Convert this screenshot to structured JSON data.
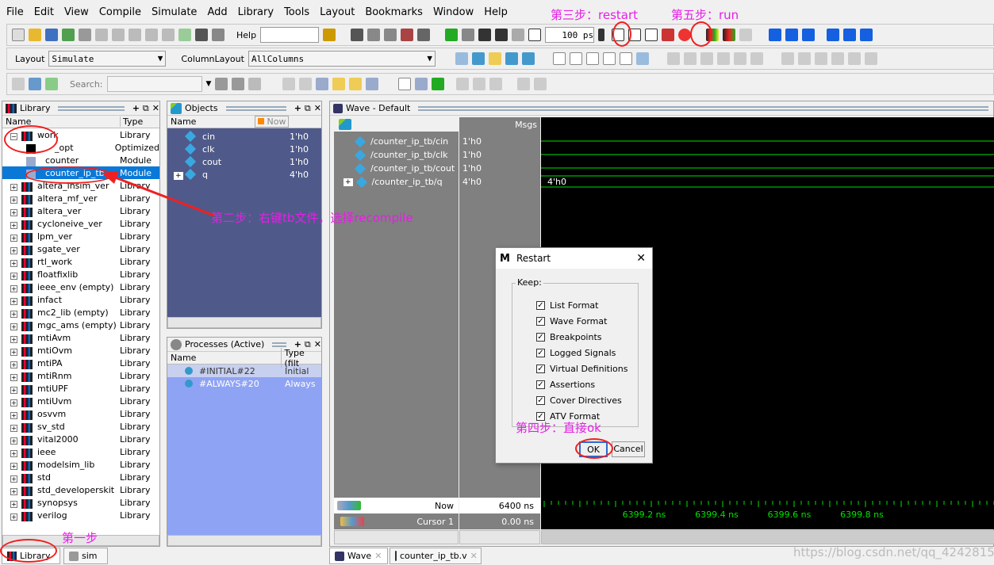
{
  "menu": [
    "File",
    "Edit",
    "View",
    "Compile",
    "Simulate",
    "Add",
    "Library",
    "Tools",
    "Layout",
    "Bookmarks",
    "Window",
    "Help"
  ],
  "toolbar": {
    "help_label": "Help",
    "help_value": "",
    "run_length": "100 ps",
    "layout_label": "Layout",
    "layout_value": "Simulate",
    "column_layout_label": "ColumnLayout",
    "column_layout_value": "AllColumns",
    "search_label": "Search:",
    "search_value": ""
  },
  "library": {
    "title": "Library",
    "col_name": "Name",
    "col_type": "Type",
    "items": [
      {
        "name": "work",
        "type": "Library",
        "level": 0,
        "expanded": true
      },
      {
        "name": "_opt",
        "type": "Optimized",
        "level": 1
      },
      {
        "name": "counter",
        "type": "Module",
        "level": 1
      },
      {
        "name": "counter_ip_tb",
        "type": "Module",
        "level": 1,
        "selected": true
      },
      {
        "name": "altera_lnsim_ver",
        "type": "Library"
      },
      {
        "name": "altera_mf_ver",
        "type": "Library"
      },
      {
        "name": "altera_ver",
        "type": "Library"
      },
      {
        "name": "cycloneive_ver",
        "type": "Library"
      },
      {
        "name": "lpm_ver",
        "type": "Library"
      },
      {
        "name": "sgate_ver",
        "type": "Library"
      },
      {
        "name": "rtl_work",
        "type": "Library"
      },
      {
        "name": "floatfixlib",
        "type": "Library"
      },
      {
        "name": "ieee_env  (empty)",
        "type": "Library"
      },
      {
        "name": "infact",
        "type": "Library"
      },
      {
        "name": "mc2_lib  (empty)",
        "type": "Library"
      },
      {
        "name": "mgc_ams  (empty)",
        "type": "Library"
      },
      {
        "name": "mtiAvm",
        "type": "Library"
      },
      {
        "name": "mtiOvm",
        "type": "Library"
      },
      {
        "name": "mtiPA",
        "type": "Library"
      },
      {
        "name": "mtiRnm",
        "type": "Library"
      },
      {
        "name": "mtiUPF",
        "type": "Library"
      },
      {
        "name": "mtiUvm",
        "type": "Library"
      },
      {
        "name": "osvvm",
        "type": "Library"
      },
      {
        "name": "sv_std",
        "type": "Library"
      },
      {
        "name": "vital2000",
        "type": "Library"
      },
      {
        "name": "ieee",
        "type": "Library"
      },
      {
        "name": "modelsim_lib",
        "type": "Library"
      },
      {
        "name": "std",
        "type": "Library"
      },
      {
        "name": "std_developerskit",
        "type": "Library"
      },
      {
        "name": "synopsys",
        "type": "Library"
      },
      {
        "name": "verilog",
        "type": "Library"
      }
    ],
    "tabs": [
      "Library",
      "sim"
    ]
  },
  "objects": {
    "title": "Objects",
    "col_name": "Name",
    "now_label": "Now",
    "items": [
      {
        "name": "cin",
        "value": "1'h0"
      },
      {
        "name": "clk",
        "value": "1'h0"
      },
      {
        "name": "cout",
        "value": "1'h0"
      },
      {
        "name": "q",
        "value": "4'h0"
      }
    ]
  },
  "processes": {
    "title": "Processes (Active)",
    "col_name": "Name",
    "col_type": "Type (filt",
    "items": [
      {
        "name": "#INITIAL#22",
        "type": "Initial"
      },
      {
        "name": "#ALWAYS#20",
        "type": "Always"
      }
    ]
  },
  "wave": {
    "title": "Wave - Default",
    "msgs_label": "Msgs",
    "signals": [
      {
        "name": "/counter_ip_tb/cin",
        "value": "1'h0"
      },
      {
        "name": "/counter_ip_tb/clk",
        "value": "1'h0"
      },
      {
        "name": "/counter_ip_tb/cout",
        "value": "1'h0"
      },
      {
        "name": "/counter_ip_tb/q",
        "value": "4'h0"
      }
    ],
    "bus_label": "4'h0",
    "now_label": "Now",
    "now_value": "6400 ns",
    "cursor_label": "Cursor 1",
    "cursor_value": "0.00 ns",
    "ticks": [
      "6399.2 ns",
      "6399.4 ns",
      "6399.6 ns",
      "6399.8 ns"
    ],
    "tabs": [
      "Wave",
      "counter_ip_tb.v"
    ],
    "wave_color": "#00e000"
  },
  "dialog": {
    "title": "Restart",
    "group": "Keep:",
    "options": [
      {
        "label": "List Format",
        "checked": true
      },
      {
        "label": "Wave Format",
        "checked": true
      },
      {
        "label": "Breakpoints",
        "checked": true
      },
      {
        "label": "Logged Signals",
        "checked": true
      },
      {
        "label": "Virtual Definitions",
        "checked": true
      },
      {
        "label": "Assertions",
        "checked": true
      },
      {
        "label": "Cover Directives",
        "checked": true
      },
      {
        "label": "ATV Format",
        "checked": true
      }
    ],
    "ok": "OK",
    "cancel": "Cancel"
  },
  "annotations": {
    "step1": "第一步",
    "step2": "第二步：右键tb文件，选择recompile",
    "step3": "第三步：restart",
    "step4": "第四步：直接ok",
    "step5": "第五步：run",
    "color": "#e61ee6"
  },
  "watermark": "https://blog.csdn.net/qq_42428154"
}
